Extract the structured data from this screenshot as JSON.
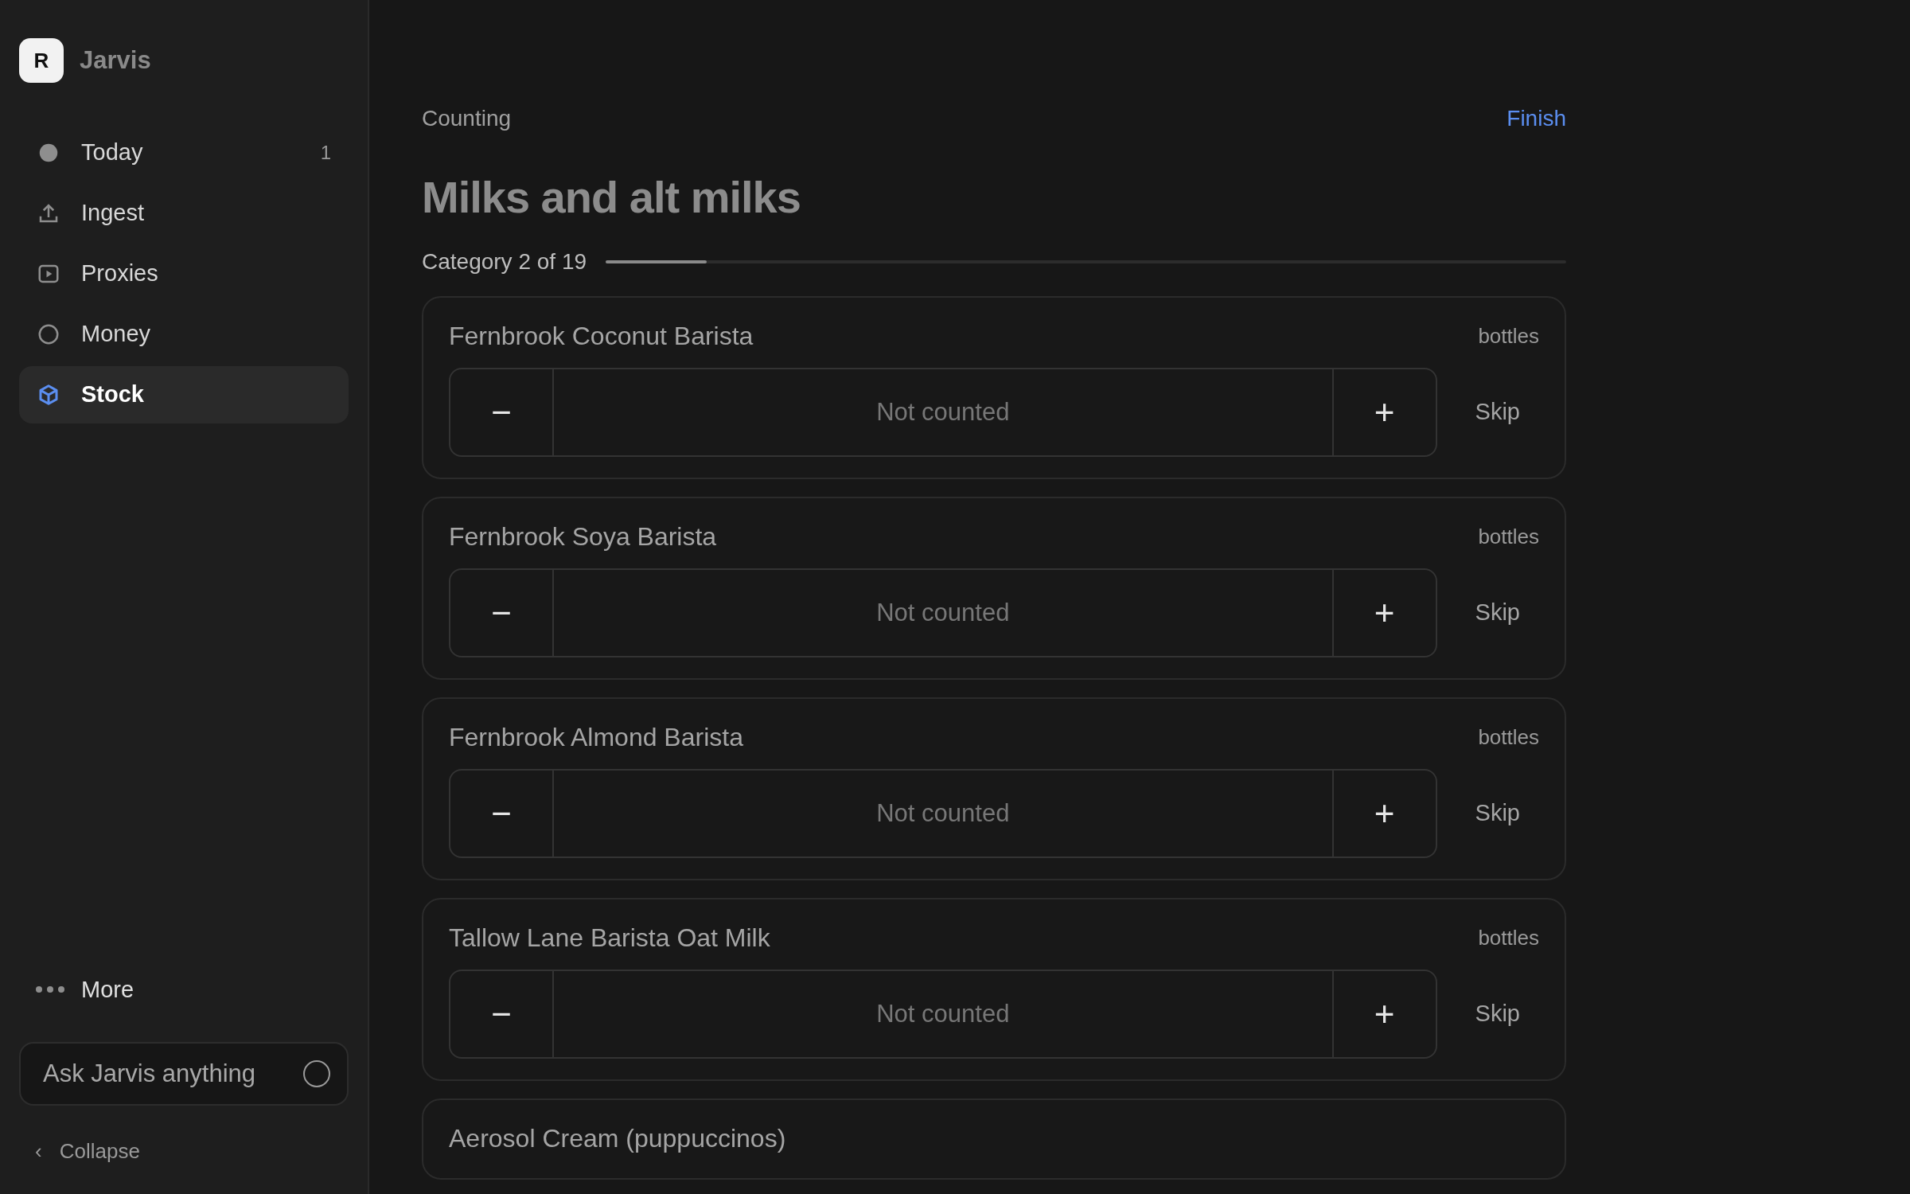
{
  "sidebar": {
    "logo_letter": "R",
    "app_name": "Jarvis",
    "items": [
      {
        "label": "Today",
        "badge": "1",
        "selected": false
      },
      {
        "label": "Ingest",
        "selected": false
      },
      {
        "label": "Proxies",
        "selected": false
      },
      {
        "label": "Money",
        "selected": false
      },
      {
        "label": "Stock",
        "selected": true
      }
    ],
    "more": "More",
    "ask": {
      "placeholder": "Ask Jarvis anything"
    },
    "collapse": {
      "icon": "‹",
      "label": "Collapse"
    }
  },
  "header": {
    "mode": "Counting",
    "finish": "Finish"
  },
  "title": "Milks and alt milks",
  "progress": {
    "label": "Category 2 of 19",
    "level": 0.105
  },
  "items": [
    {
      "name": "Fernbrook Coconut Barista",
      "unit": "bottles",
      "minus": "−",
      "value": "Not counted",
      "plus": "+",
      "skip": "Skip"
    },
    {
      "name": "Fernbrook Soya Barista",
      "unit": "bottles",
      "minus": "−",
      "value": "Not counted",
      "plus": "+",
      "skip": "Skip"
    },
    {
      "name": "Fernbrook Almond Barista",
      "unit": "bottles",
      "minus": "−",
      "value": "Not counted",
      "plus": "+",
      "skip": "Skip"
    },
    {
      "name": "Tallow Lane Barista Oat Milk",
      "unit": "bottles",
      "minus": "−",
      "value": "Not counted",
      "plus": "+",
      "skip": "Skip"
    },
    {
      "name": "Aerosol Cream (puppuccinos)"
    }
  ]
}
